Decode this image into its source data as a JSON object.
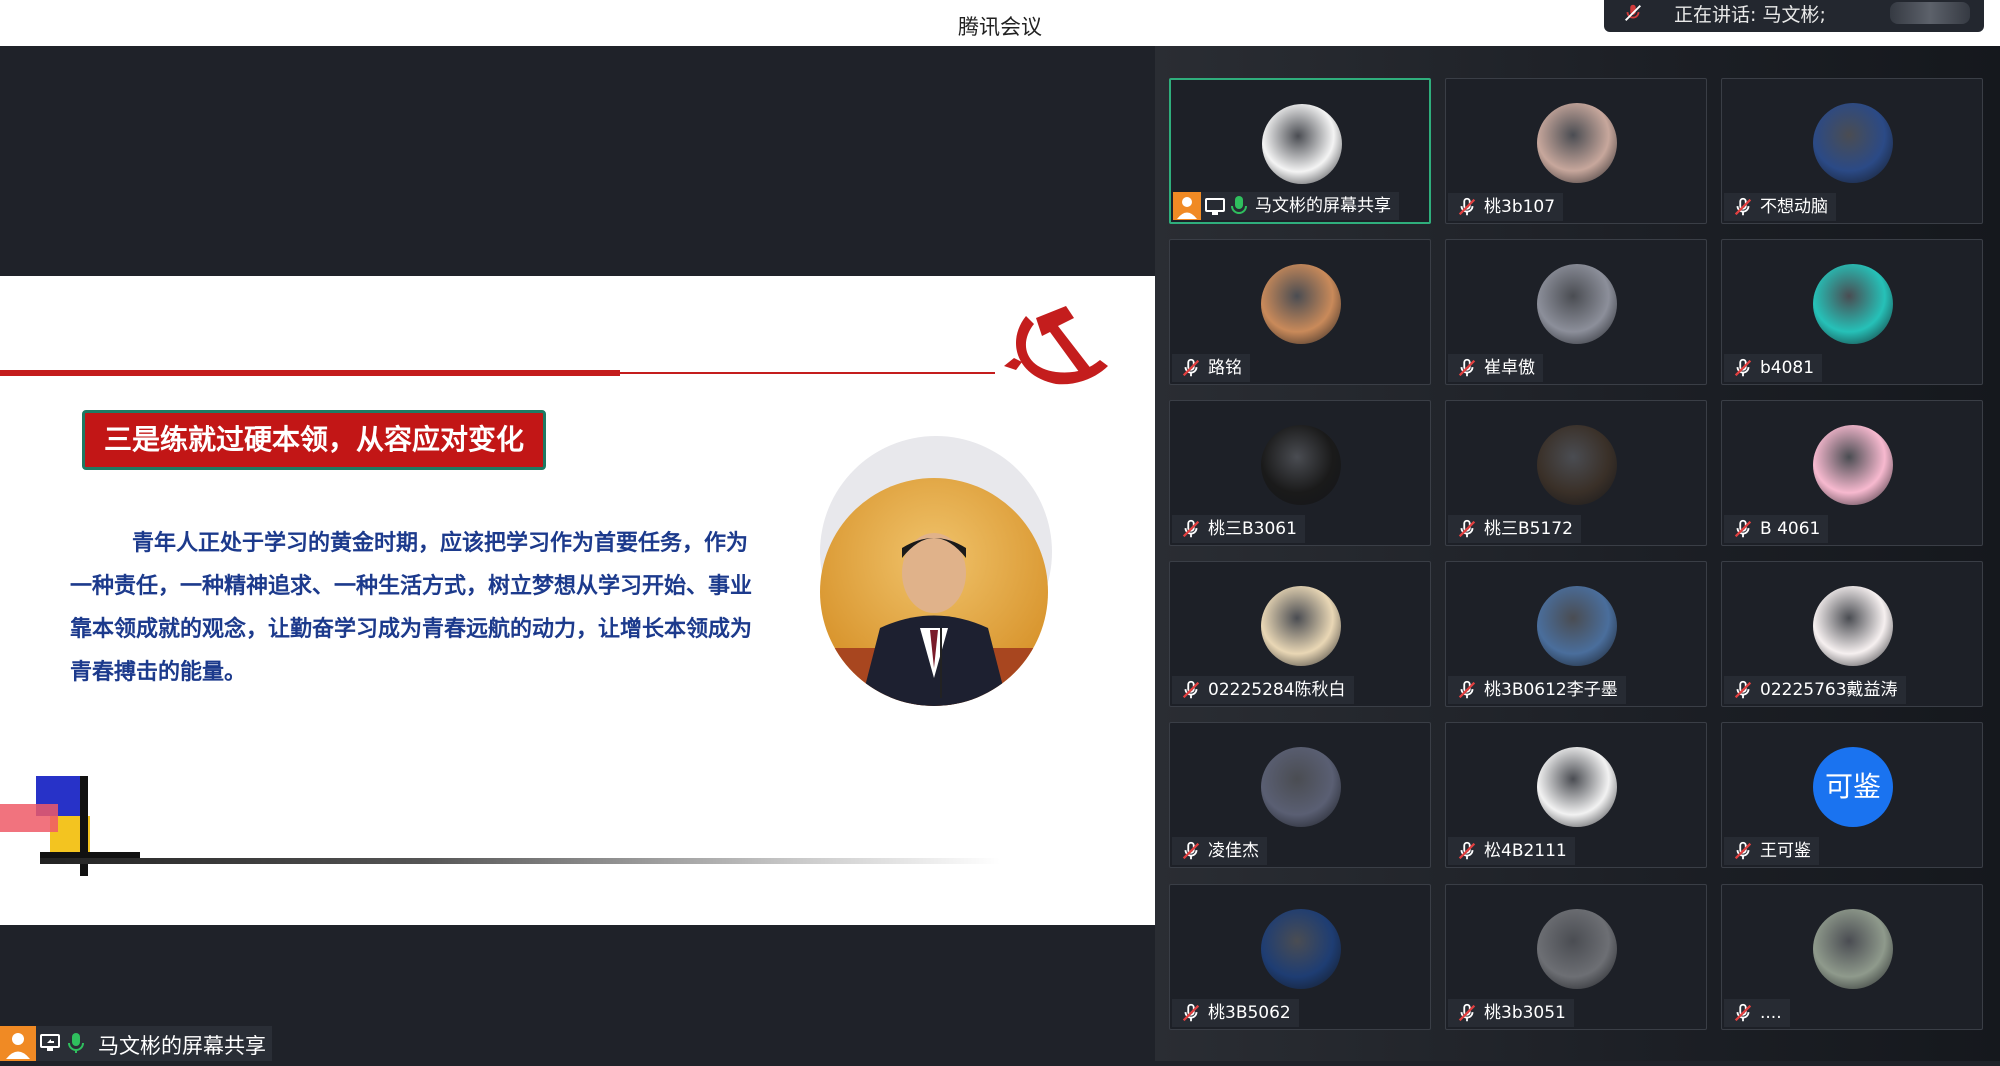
{
  "app": {
    "title": "腾讯会议"
  },
  "speaking": {
    "label": "正在讲话: 马文彬;"
  },
  "slide": {
    "heading": "三是练就过硬本领，从容应对变化",
    "paragraph": "青年人正处于学习的黄金时期，应该把学习作为首要任务，作为一种责任，一种精神追求、一种生活方式，树立梦想从学习开始、事业靠本领成就的观念，让勤奋学习成为青春远航的动力，让增长本领成为青春搏击的能量。"
  },
  "share": {
    "label": "马文彬的屏幕共享"
  },
  "participants": [
    {
      "name": "马文彬的屏幕共享",
      "muted": false,
      "host": true,
      "avatar": "family-cartoon-avatar",
      "color": "#f4f4f4"
    },
    {
      "name": "桃3b107",
      "muted": true,
      "avatar": "plush-toy-avatar",
      "color": "#c7a79c"
    },
    {
      "name": "不想动脑",
      "muted": true,
      "avatar": "anime-girl-avatar",
      "color": "#2b4a86"
    },
    {
      "name": "路铭",
      "muted": true,
      "avatar": "sunglasses-man-avatar",
      "color": "#c98a5a"
    },
    {
      "name": "崔卓傲",
      "muted": true,
      "avatar": "anime-fighter-avatar",
      "color": "#8c8f9a"
    },
    {
      "name": "b4081",
      "muted": true,
      "avatar": "superman-avatar",
      "color": "#26c1b8"
    },
    {
      "name": "桃三B3061",
      "muted": true,
      "avatar": "calligraphy-avatar",
      "color": "#1a1a1a"
    },
    {
      "name": "桃三B5172",
      "muted": true,
      "avatar": "photo-person-avatar",
      "color": "#3a3028"
    },
    {
      "name": "B 4061",
      "muted": true,
      "avatar": "pikachu-avatar",
      "color": "#f7b9cf"
    },
    {
      "name": "02225284陈秋白",
      "muted": true,
      "avatar": "cartoon-boy-avatar",
      "color": "#e9d7b5"
    },
    {
      "name": "桃3B0612李子墨",
      "muted": true,
      "avatar": "snowflake-avatar",
      "color": "#4a6e9c"
    },
    {
      "name": "02225763戴益涛",
      "muted": true,
      "avatar": "eye-sketch-avatar",
      "color": "#f6f0f0"
    },
    {
      "name": "凌佳杰",
      "muted": true,
      "avatar": "anime-white-hair-avatar",
      "color": "#5a5f73"
    },
    {
      "name": "松4B2111",
      "muted": true,
      "avatar": "anime-boy-avatar",
      "color": "#f2f2f2"
    },
    {
      "name": "王可鉴",
      "muted": true,
      "avatar": "text-avatar",
      "avatar_text": "可鉴",
      "color": "#1a73f0"
    },
    {
      "name": "桃3B5062",
      "muted": true,
      "avatar": "night-sky-avatar",
      "color": "#1e3d73"
    },
    {
      "name": "桃3b3051",
      "muted": true,
      "avatar": "masked-person-avatar",
      "color": "#6d6f74"
    },
    {
      "name": "....",
      "muted": true,
      "avatar": "street-photo-avatar",
      "color": "#8f9a8c"
    }
  ]
}
